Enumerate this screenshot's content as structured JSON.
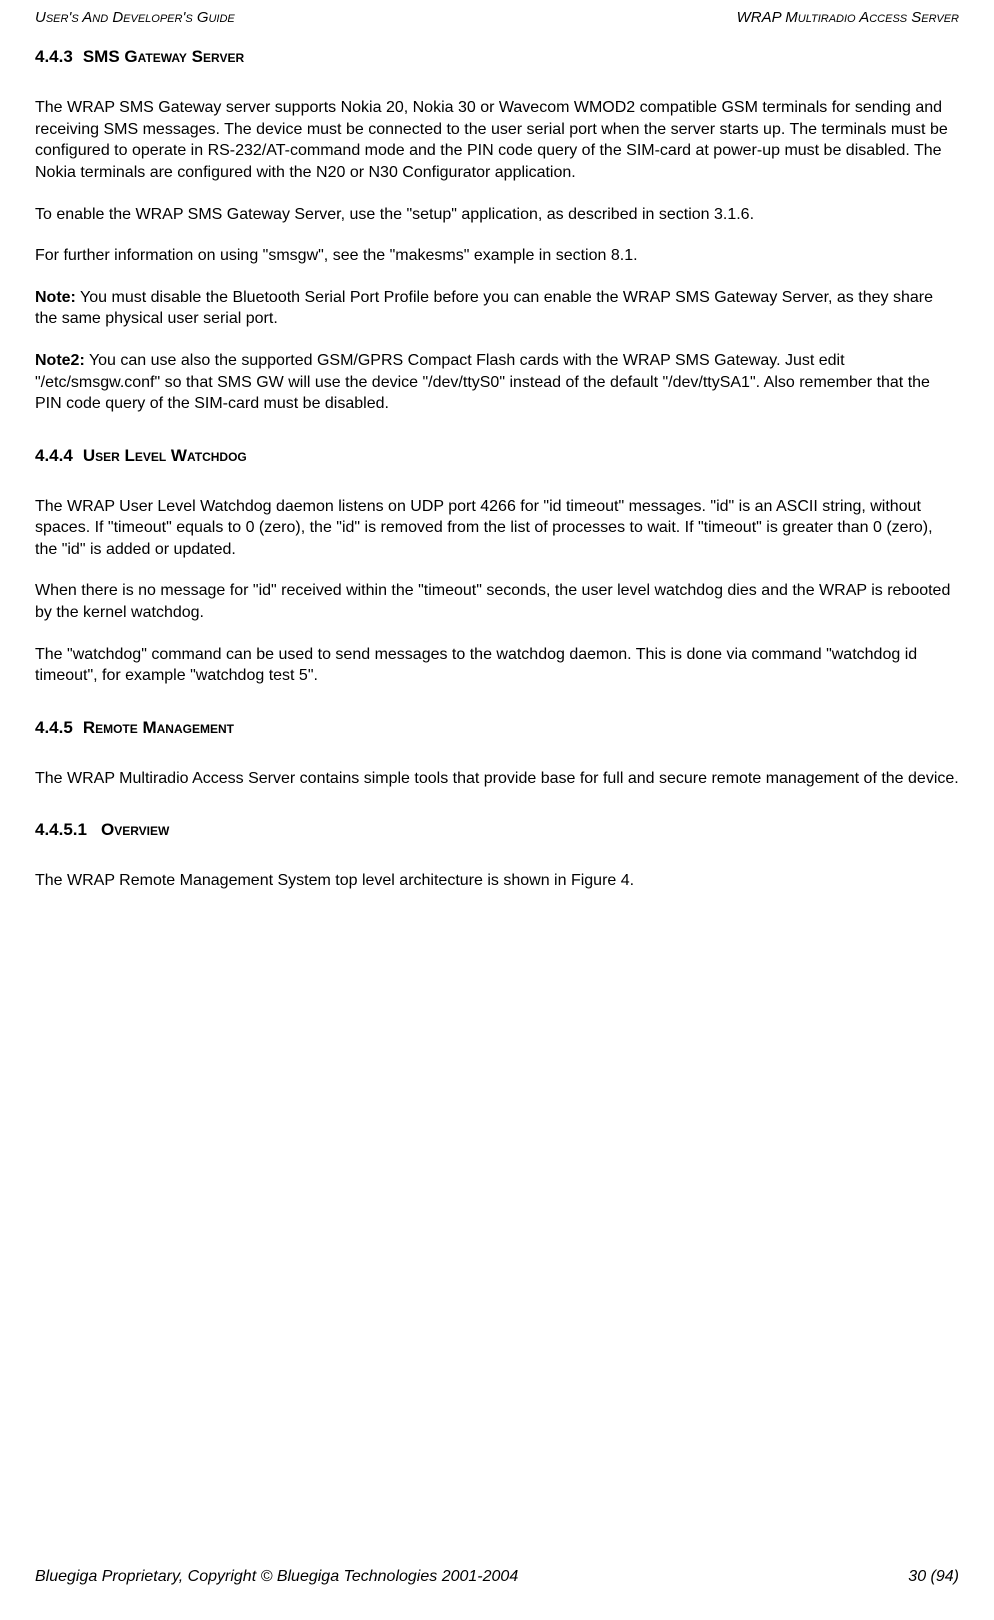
{
  "header": {
    "left": "User's And Developer's Guide",
    "right": "WRAP Multiradio Access Server"
  },
  "sections": {
    "s1": {
      "num": "4.4.3",
      "title": "SMS Gateway Server",
      "p1": "The WRAP SMS Gateway server supports Nokia 20, Nokia 30 or Wavecom WMOD2 compatible GSM terminals for sending and receiving SMS messages. The device must be connected to the user serial port when the server starts up. The terminals must be configured to operate in RS-232/AT-command mode and the PIN code query of the SIM-card at power-up must be disabled. The Nokia terminals are configured with the N20 or N30 Configurator application.",
      "p2": "To enable the WRAP SMS Gateway Server, use the \"setup\" application, as described in section 3.1.6.",
      "p3": "For further information on using \"smsgw\", see the \"makesms\" example in section 8.1.",
      "note1_label": "Note:",
      "note1_text": " You must disable the Bluetooth Serial Port Profile before you can enable the WRAP SMS Gateway Server, as they share the same physical user serial port.",
      "note2_label": "Note2:",
      "note2_text": " You can use also the supported GSM/GPRS Compact Flash cards with the WRAP SMS Gateway. Just edit \"/etc/smsgw.conf\" so that SMS GW will use the device \"/dev/ttyS0\" instead of the default \"/dev/ttySA1\". Also remember that the PIN code query of the SIM-card must be disabled."
    },
    "s2": {
      "num": "4.4.4",
      "title": "User Level Watchdog",
      "p1": "The WRAP User Level Watchdog daemon listens on UDP port 4266 for \"id timeout\" messages. \"id\" is an ASCII string, without spaces. If \"timeout\" equals to 0 (zero), the \"id\" is removed from the list of processes to wait. If \"timeout\" is greater than 0 (zero), the \"id\" is added or updated.",
      "p2": "When there is no message for \"id\" received within the \"timeout\" seconds, the user level watchdog dies and the WRAP is rebooted by the kernel watchdog.",
      "p3": "The \"watchdog\" command can be used to send messages to the watchdog daemon. This is done via command \"watchdog id timeout\", for example \"watchdog test 5\"."
    },
    "s3": {
      "num": "4.4.5",
      "title": "Remote Management",
      "p1": "The WRAP Multiradio Access Server contains simple tools that provide base for full and secure remote management of the device."
    },
    "s4": {
      "num": "4.4.5.1",
      "title": "Overview",
      "p1": "The WRAP Remote Management System top level architecture is shown in Figure 4."
    }
  },
  "footer": {
    "left": "Bluegiga Proprietary, Copyright © Bluegiga Technologies 2001-2004",
    "right": "30 (94)"
  }
}
